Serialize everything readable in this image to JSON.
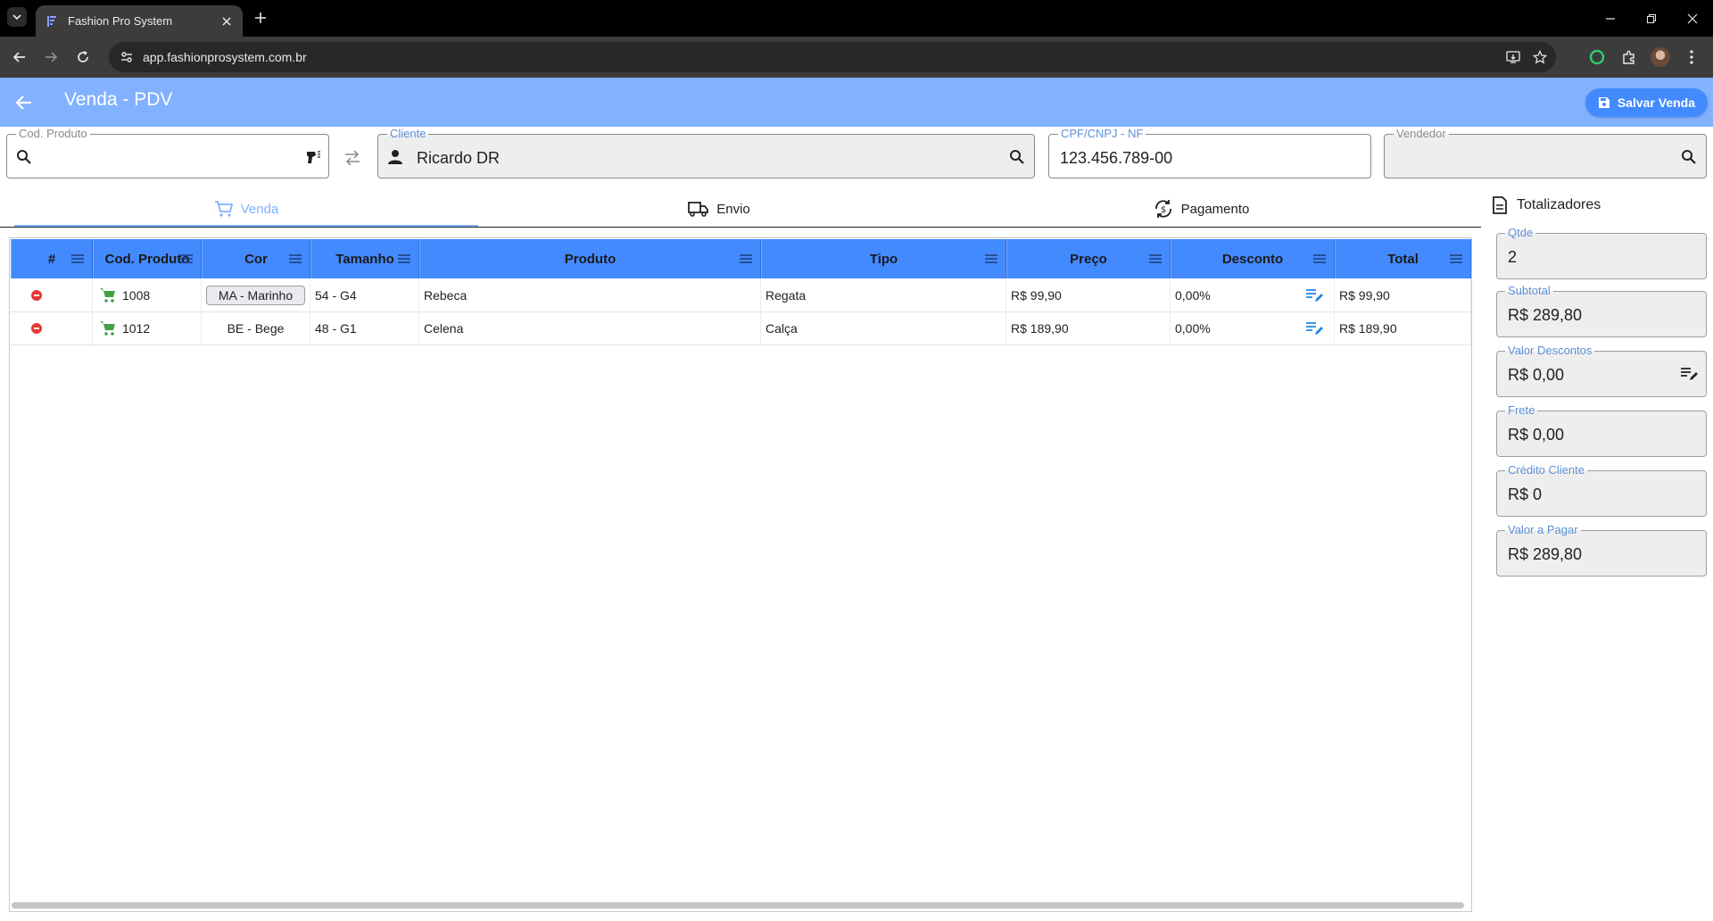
{
  "browser": {
    "tab_title": "Fashion Pro System",
    "url": "app.fashionprosystem.com.br"
  },
  "header": {
    "title": "Venda - PDV",
    "save_label": "Salvar Venda"
  },
  "fields": {
    "cod_produto": {
      "label": "Cod. Produto",
      "value": ""
    },
    "cliente": {
      "label": "Cliente",
      "value": "Ricardo DR"
    },
    "cpf": {
      "label": "CPF/CNPJ - NF",
      "value": "123.456.789-00"
    },
    "vendedor": {
      "label": "Vendedor",
      "value": ""
    }
  },
  "tabs": [
    {
      "label": "Venda",
      "icon": "cart-icon",
      "active": true
    },
    {
      "label": "Envio",
      "icon": "truck-icon",
      "active": false
    },
    {
      "label": "Pagamento",
      "icon": "payment-icon",
      "active": false
    }
  ],
  "totalizadores": {
    "title": "Totalizadores",
    "qtde": {
      "label": "Qtde",
      "value": "2"
    },
    "subtotal": {
      "label": "Subtotal",
      "value": "R$ 289,80"
    },
    "descontos": {
      "label": "Valor Descontos",
      "value": "R$ 0,00"
    },
    "frete": {
      "label": "Frete",
      "value": "R$ 0,00"
    },
    "credito": {
      "label": "Crédito Cliente",
      "value": "R$ 0"
    },
    "pagar": {
      "label": "Valor a Pagar",
      "value": "R$ 289,80"
    }
  },
  "grid": {
    "columns": [
      "#",
      "Cod. Produto",
      "Cor",
      "Tamanho",
      "Produto",
      "Tipo",
      "Preço",
      "Desconto",
      "Total"
    ],
    "rows": [
      {
        "cod": "1008",
        "cor": "MA - Marinho",
        "tamanho": "54 - G4",
        "produto": "Rebeca",
        "tipo": "Regata",
        "preco": "R$ 99,90",
        "desconto": "0,00%",
        "total": "R$ 99,90"
      },
      {
        "cod": "1012",
        "cor": "BE - Bege",
        "tamanho": "48 - G1",
        "produto": "Celena",
        "tipo": "Calça",
        "preco": "R$ 189,90",
        "desconto": "0,00%",
        "total": "R$ 189,90"
      }
    ]
  },
  "colors": {
    "header_bg": "#82b1ff",
    "grid_header_bg": "#448aff",
    "save_button_bg": "#448aff",
    "remove": "#e53935",
    "cart": "#43a047"
  }
}
